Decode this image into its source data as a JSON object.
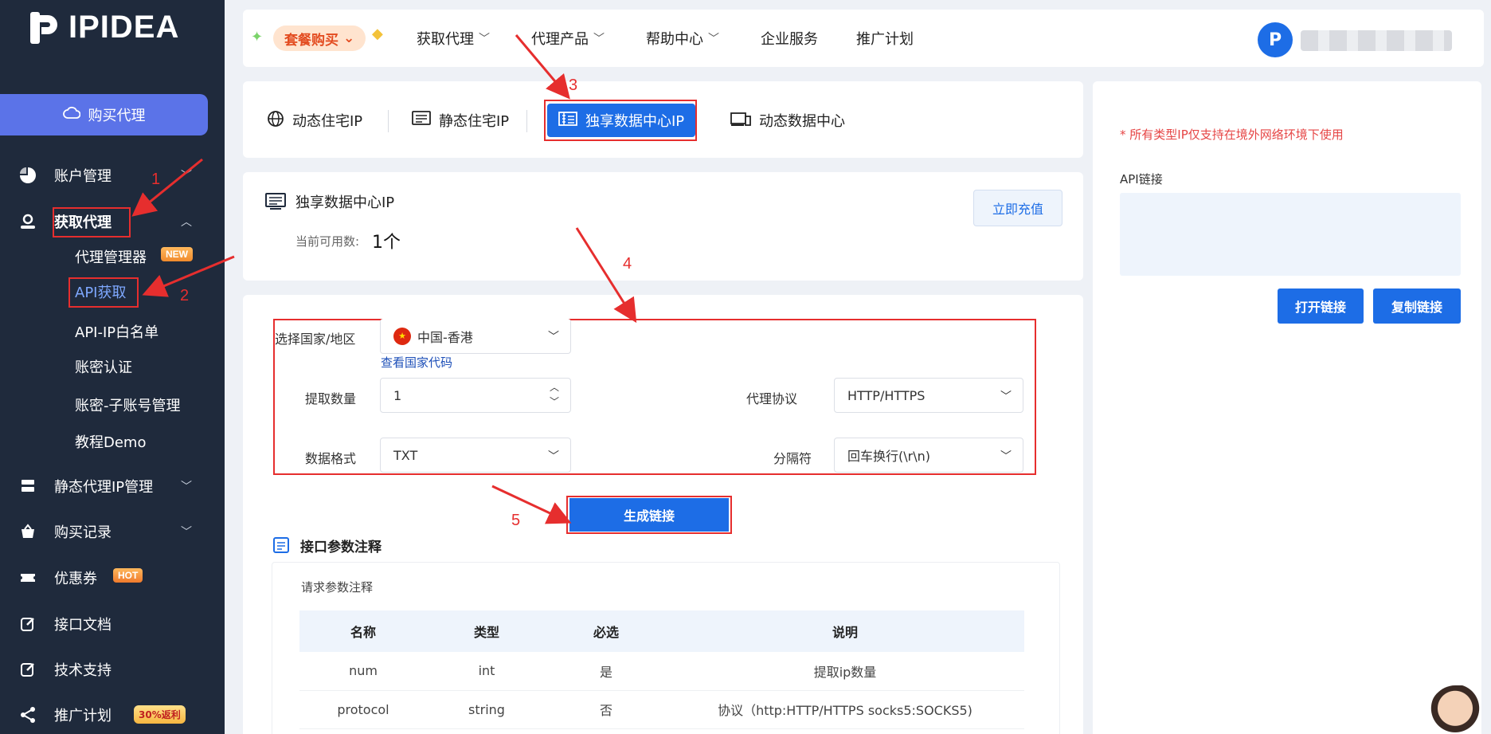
{
  "sidebar": {
    "logo_text": "IPIDEA",
    "buy_button": "购买代理",
    "items": {
      "account": "账户管理",
      "get_proxy": "获取代理",
      "static_proxy": "静态代理IP管理",
      "records": "购买记录",
      "coupons": "优惠券",
      "docs": "接口文档",
      "support": "技术支持",
      "promo": "推广计划"
    },
    "sub_items": {
      "proxy_manager": "代理管理器",
      "api": "API获取",
      "whitelist": "API-IP白名单",
      "auth": "账密认证",
      "subaccount": "账密-子账号管理",
      "demo": "教程Demo"
    },
    "badges": {
      "new": "NEW",
      "hot": "HOT",
      "rebate": "30%返利"
    }
  },
  "header": {
    "promo": "套餐购买",
    "menu": [
      "获取代理",
      "代理产品",
      "帮助中心",
      "企业服务",
      "推广计划"
    ],
    "avatar_letter": "P"
  },
  "product_tabs": [
    "动态住宅IP",
    "静态住宅IP",
    "独享数据中心IP",
    "动态数据中心"
  ],
  "info": {
    "title": "独享数据中心IP",
    "available_label": "当前可用数:",
    "available_value": "1个",
    "recharge": "立即充值"
  },
  "form": {
    "country_label": "选择国家/地区",
    "country_value": "中国-香港",
    "country_code_link": "查看国家代码",
    "quantity_label": "提取数量",
    "quantity_value": "1",
    "protocol_label": "代理协议",
    "protocol_value": "HTTP/HTTPS",
    "format_label": "数据格式",
    "format_value": "TXT",
    "separator_label": "分隔符",
    "separator_value": "回车换行(\\r\\n)",
    "generate": "生成链接"
  },
  "params": {
    "title": "接口参数注释",
    "subtitle": "请求参数注释",
    "headers": [
      "名称",
      "类型",
      "必选",
      "说明"
    ],
    "rows": [
      [
        "num",
        "int",
        "是",
        "提取ip数量"
      ],
      [
        "protocol",
        "string",
        "否",
        "协议（http:HTTP/HTTPS socks5:SOCKS5)"
      ]
    ]
  },
  "right": {
    "notice": "* 所有类型IP仅支持在境外网络环境下使用",
    "api_label": "API链接",
    "open": "打开链接",
    "copy": "复制链接"
  },
  "annotations": [
    "1",
    "2",
    "3",
    "4",
    "5"
  ],
  "colors": {
    "sidebar": "#1f2a3c",
    "accent": "#1d6de6",
    "annotation": "#e62e2e",
    "buy_button": "#5b73e8"
  }
}
